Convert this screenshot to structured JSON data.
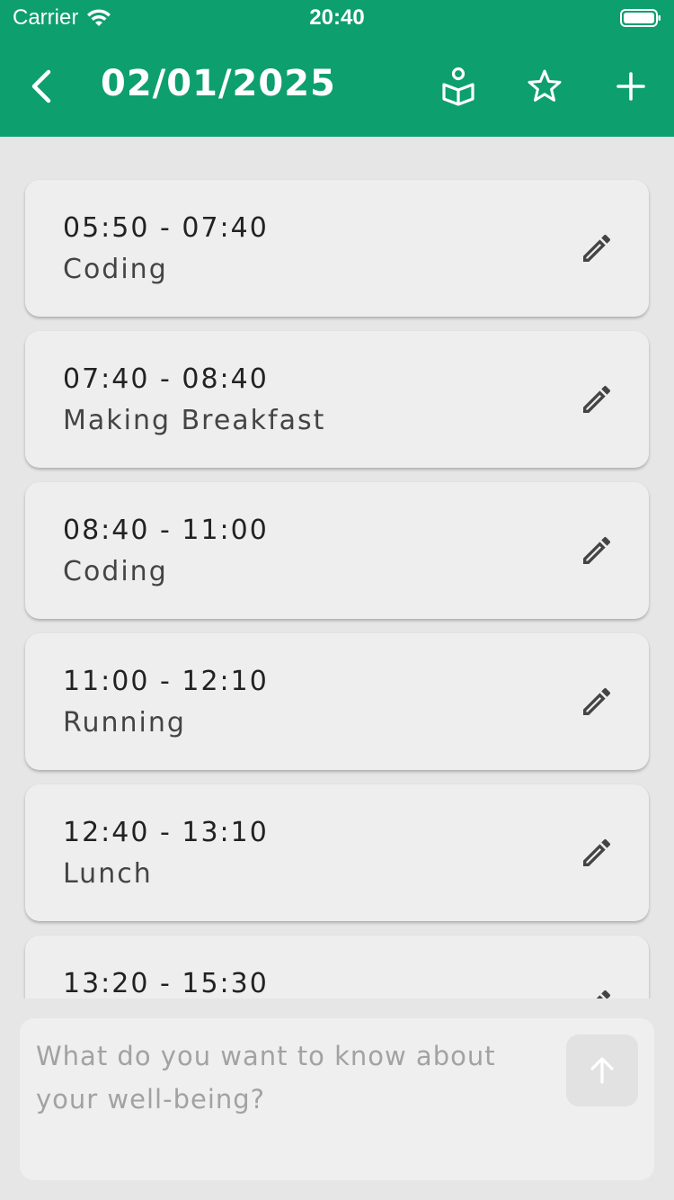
{
  "status": {
    "carrier": "Carrier",
    "time": "20:40"
  },
  "header": {
    "title": "02/01/2025",
    "color": "#0e9f6e",
    "icons": [
      "back-icon",
      "book-reader-icon",
      "star-icon",
      "plus-icon"
    ]
  },
  "entries": [
    {
      "range": "05:50 - 07:40",
      "activity": "Coding"
    },
    {
      "range": "07:40 - 08:40",
      "activity": "Making Breakfast"
    },
    {
      "range": "08:40 - 11:00",
      "activity": "Coding"
    },
    {
      "range": "11:00 - 12:10",
      "activity": "Running"
    },
    {
      "range": "12:40 - 13:10",
      "activity": "Lunch"
    },
    {
      "range": "13:20 - 15:30",
      "activity": ""
    }
  ],
  "composer": {
    "placeholder": "What do you want to know about your well-being?",
    "value": ""
  }
}
